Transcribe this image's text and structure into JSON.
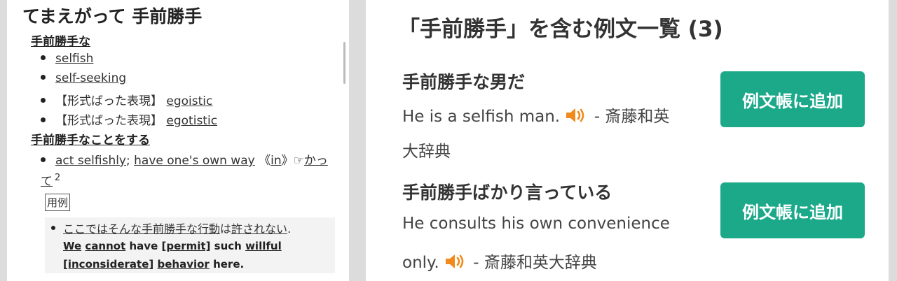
{
  "left": {
    "title": "てまえがって 手前勝手",
    "senses": [
      {
        "heading": "手前勝手な",
        "items": [
          {
            "prefix": "",
            "link": "selfish"
          },
          {
            "prefix": "",
            "link": "self-seeking"
          },
          {
            "prefix": "【形式ばった表現】 ",
            "link": "egoistic"
          },
          {
            "prefix": "【形式ばった表現】 ",
            "link": "egotistic"
          }
        ]
      },
      {
        "heading": "手前勝手なことをする",
        "line1": {
          "link1": "act selfishly",
          "sep": "; ",
          "link2": "have one's own way",
          "mid1": " 《",
          "link3": "in",
          "mid2": "》☞",
          "link4": "かっ"
        },
        "line2": {
          "link": "て",
          "sup": "2"
        }
      }
    ],
    "yourei_label": "用例",
    "example": {
      "jp_link1": "ここではそんな手前勝手な",
      "jp_link2": "行動",
      "jp_plain1": "は",
      "jp_link3": "許されない",
      "jp_plain2": ".",
      "en_w1": "We",
      "en_w2": "cannot",
      "en_w3": " have ",
      "en_w4": "[permit]",
      "en_w5": " such ",
      "en_w6": "willful",
      "en_w7": "[inconsiderate]",
      "en_w8": " ",
      "en_w9": "behavior",
      "en_w10": " here."
    }
  },
  "right": {
    "title": "「手前勝手」を含む例文一覧 (3)",
    "examples": [
      {
        "jp": "手前勝手な男だ",
        "en_line1": "He is a selfish man. ",
        "source_inline": " - 斎藤和英",
        "line2": "大辞典",
        "button": "例文帳に追加"
      },
      {
        "jp": "手前勝手ばかり言っている",
        "en_line1": "He consults his own convenience",
        "line2_pre": "only. ",
        "line2_source": " - 斎藤和英大辞典",
        "button": "例文帳に追加"
      }
    ]
  },
  "colors": {
    "button_green": "#1ba98a",
    "speaker_orange": "#f08a1c"
  },
  "icons": {
    "speaker": "speaker-icon"
  }
}
